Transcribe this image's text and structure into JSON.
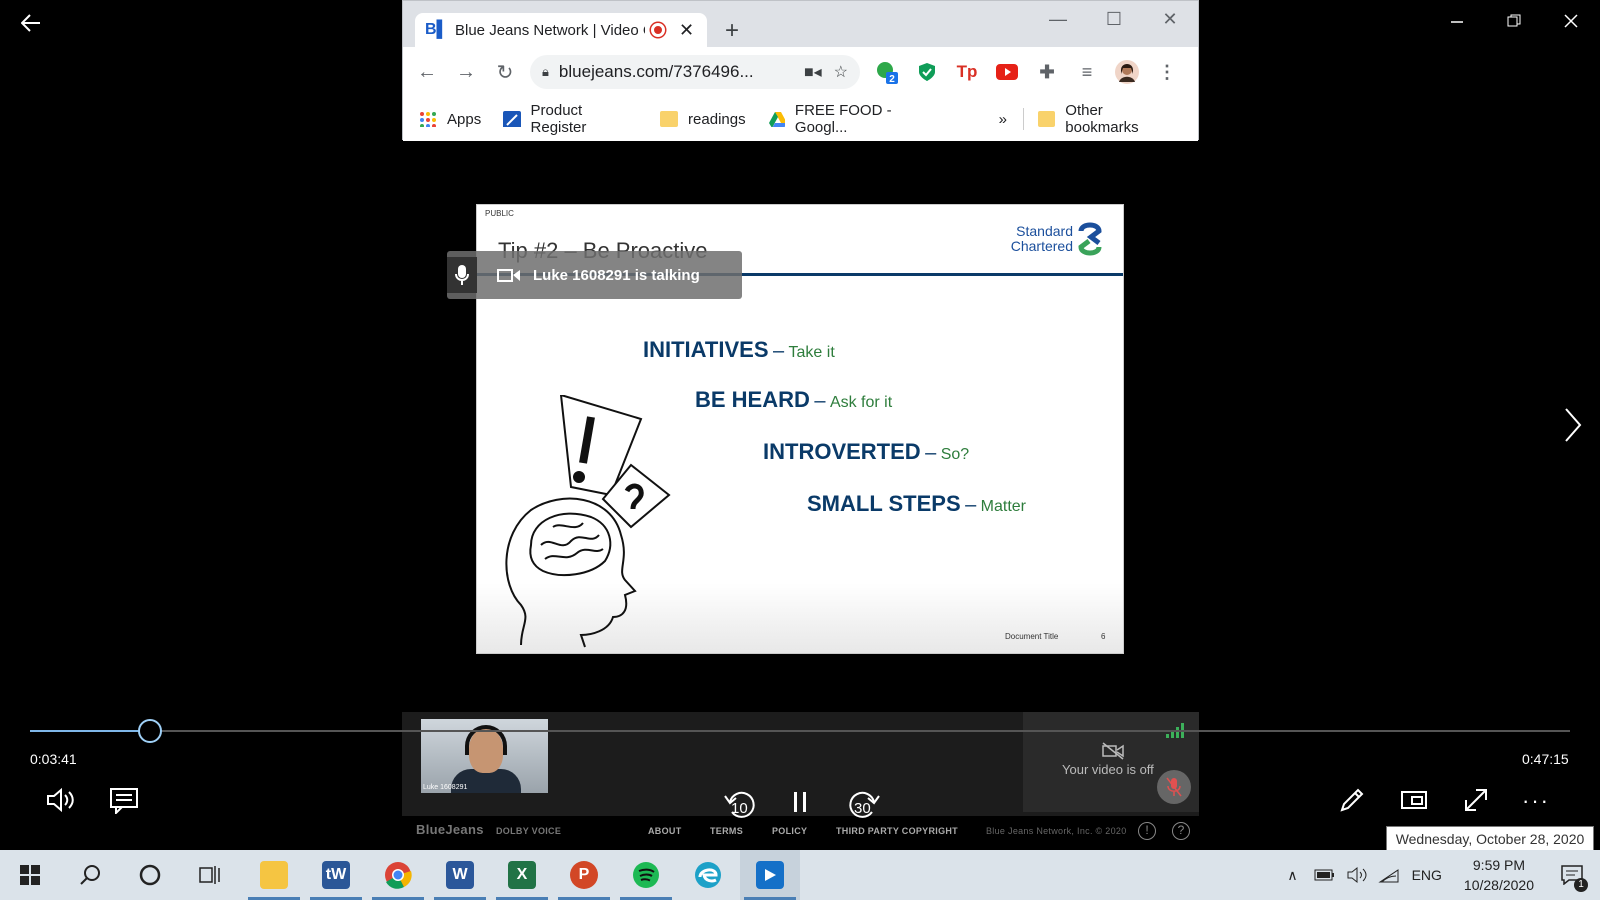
{
  "browser": {
    "tab_title": "Blue Jeans Network | Video C",
    "url": "bluejeans.com/7376496...",
    "extension_badge": "2",
    "bookmarks": [
      {
        "label": "Apps",
        "icon": "apps-grid-icon"
      },
      {
        "label": "Product Register",
        "icon": "product-register-icon"
      },
      {
        "label": "readings",
        "icon": "folder-icon"
      },
      {
        "label": "FREE FOOD - Googl...",
        "icon": "google-drive-icon"
      }
    ],
    "overflow": "»",
    "other_bookmarks": "Other bookmarks"
  },
  "slide": {
    "public_tag": "PUBLIC",
    "title": "Tip #2 – Be Proactive",
    "logo_line1": "Standard",
    "logo_line2": "Chartered",
    "lines": [
      {
        "big": "INITIATIVES",
        "dash": "–",
        "small": "Take it"
      },
      {
        "big": "BE HEARD",
        "dash": "–",
        "small": "Ask for it"
      },
      {
        "big": "INTROVERTED",
        "dash": "–",
        "small": "So?"
      },
      {
        "big": "SMALL STEPS",
        "dash": "–",
        "small": "Matter"
      }
    ],
    "doc_title": "Document Title",
    "page_number": "6"
  },
  "meeting": {
    "talking_label": "Luke 1608291 is talking",
    "remote_video_label": "Luke 1608291",
    "self_video_status": "Your video is off"
  },
  "player": {
    "elapsed": "0:03:41",
    "duration": "0:47:15",
    "progress_fraction": 0.078,
    "rewind_label": "10",
    "forward_label": "30"
  },
  "bluejeans_footer": {
    "brand": "BlueJeans",
    "dolby": "DOLBY VOICE",
    "links": [
      "ABOUT",
      "TERMS",
      "POLICY",
      "THIRD PARTY COPYRIGHT"
    ],
    "copyright": "Blue Jeans Network, Inc. © 2020"
  },
  "tooltip": "Wednesday, October 28, 2020",
  "taskbar": {
    "language": "ENG",
    "time": "9:59 PM",
    "date": "10/28/2020",
    "notification_count": "1",
    "apps": [
      "file-explorer",
      "tw",
      "chrome",
      "word",
      "excel",
      "powerpoint",
      "spotify",
      "edge",
      "movies-tv"
    ]
  },
  "colors": {
    "slide_navy": "#0a3a68",
    "slide_green": "#2e7d3c",
    "progress": "#7fb7e8"
  }
}
